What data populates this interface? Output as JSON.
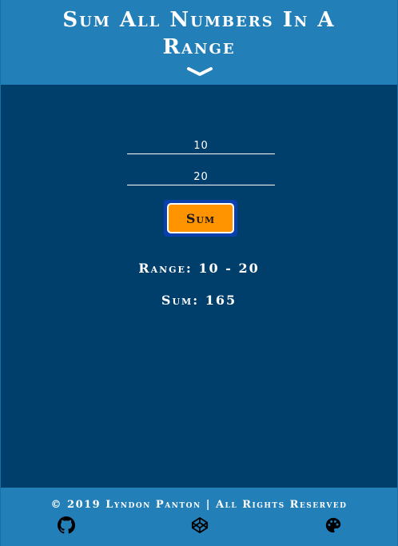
{
  "header": {
    "title": "Sum All Numbers In A Range",
    "toggle_icon": "chevron-down-icon"
  },
  "form": {
    "start_value": "10",
    "end_value": "20",
    "sum_button_label": "Sum"
  },
  "results": {
    "range_text": "Range: 10 - 20",
    "sum_text": "Sum: 165"
  },
  "footer": {
    "copyright": "© 2019 Lyndon Panton | All Rights Reserved",
    "links": [
      {
        "icon": "github-icon"
      },
      {
        "icon": "codepen-icon"
      },
      {
        "icon": "palette-icon"
      }
    ]
  },
  "colors": {
    "header_bg": "#237fb7",
    "main_bg": "#003f6b",
    "button_bg": "#ff9300",
    "button_focus_ring": "#0a3fae"
  }
}
